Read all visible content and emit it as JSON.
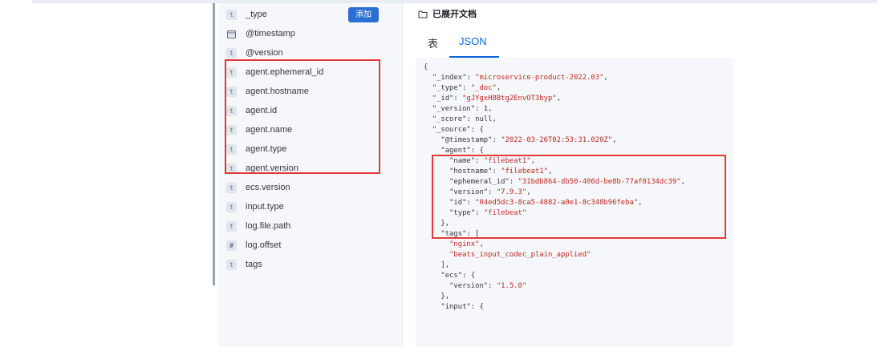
{
  "fields_panel": {
    "add_button_label": "添加",
    "fields": [
      {
        "type": "t",
        "name": "_type"
      },
      {
        "type": "date",
        "name": "@timestamp"
      },
      {
        "type": "t",
        "name": "@version"
      },
      {
        "type": "t",
        "name": "agent.ephemeral_id"
      },
      {
        "type": "t",
        "name": "agent.hostname"
      },
      {
        "type": "t",
        "name": "agent.id"
      },
      {
        "type": "t",
        "name": "agent.name"
      },
      {
        "type": "t",
        "name": "agent.type"
      },
      {
        "type": "t",
        "name": "agent.version"
      },
      {
        "type": "t",
        "name": "ecs.version"
      },
      {
        "type": "t",
        "name": "input.type"
      },
      {
        "type": "t",
        "name": "log.file.path"
      },
      {
        "type": "#",
        "name": "log.offset"
      },
      {
        "type": "t",
        "name": "tags"
      }
    ]
  },
  "document": {
    "title": "已展开文档",
    "tabs": {
      "table": "表",
      "json": "JSON"
    },
    "json_lines": [
      [
        "{",
        null,
        null
      ],
      [
        "  ",
        "\"_index\"",
        ": ",
        "\"microservice-product-2022.03\"",
        ","
      ],
      [
        "  ",
        "\"_type\"",
        ": ",
        "\"_doc\"",
        ","
      ],
      [
        "  ",
        "\"_id\"",
        ": ",
        "\"gJYgxH8Btg2EnvOT3byp\"",
        ","
      ],
      [
        "  ",
        "\"_version\"",
        ": 1,"
      ],
      [
        "  ",
        "\"_score\"",
        ": null,"
      ],
      [
        "  ",
        "\"_source\"",
        ": {"
      ],
      [
        "    ",
        "\"@timestamp\"",
        ": ",
        "\"2022-03-26T02:53:31.020Z\"",
        ","
      ],
      [
        "    ",
        "\"agent\"",
        ": {"
      ],
      [
        "      ",
        "\"name\"",
        ": ",
        "\"filebeat1\"",
        ","
      ],
      [
        "      ",
        "\"hostname\"",
        ": ",
        "\"filebeat1\"",
        ","
      ],
      [
        "      ",
        "\"ephemeral_id\"",
        ": ",
        "\"31bdb864-db50-406d-be8b-77af0134dc39\"",
        ","
      ],
      [
        "      ",
        "\"version\"",
        ": ",
        "\"7.9.3\"",
        ","
      ],
      [
        "      ",
        "\"id\"",
        ": ",
        "\"04ed5dc3-8ca5-4882-a0e1-8c348b96feba\"",
        ","
      ],
      [
        "      ",
        "\"type\"",
        ": ",
        "\"filebeat\"",
        ""
      ],
      [
        "    },",
        null,
        null
      ],
      [
        "    ",
        "\"tags\"",
        ": ["
      ],
      [
        "      ",
        null,
        null,
        "\"nginx\"",
        ","
      ],
      [
        "      ",
        null,
        null,
        "\"beats_input_codec_plain_applied\"",
        ""
      ],
      [
        "    ],",
        null,
        null
      ],
      [
        "    ",
        "\"ecs\"",
        ": {"
      ],
      [
        "      ",
        "\"version\"",
        ": ",
        "\"1.5.0\"",
        ""
      ],
      [
        "    },",
        null,
        null
      ],
      [
        "    ",
        "\"input\"",
        ": {"
      ]
    ]
  },
  "colors": {
    "accent": "#0b64dd",
    "highlight_box": "#e23a3a",
    "string_value": "#bd271e",
    "button": "#2a6fd1"
  }
}
